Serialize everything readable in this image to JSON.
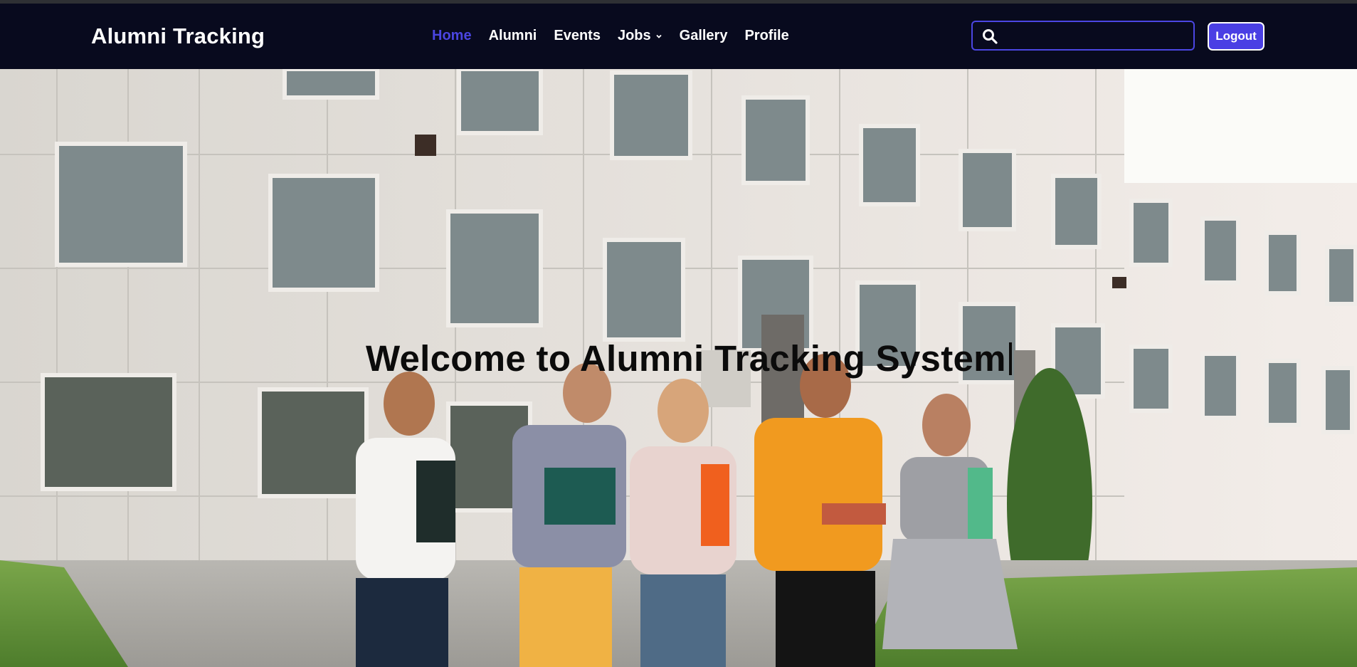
{
  "app": {
    "brand": "Alumni Tracking"
  },
  "nav": {
    "items": [
      {
        "label": "Home",
        "active": true
      },
      {
        "label": "Alumni",
        "active": false
      },
      {
        "label": "Events",
        "active": false
      },
      {
        "label": "Jobs",
        "active": false,
        "has_dropdown": true
      },
      {
        "label": "Gallery",
        "active": false
      },
      {
        "label": "Profile",
        "active": false
      }
    ]
  },
  "search": {
    "value": "",
    "placeholder": "",
    "icon": "search-icon"
  },
  "auth": {
    "logout_label": "Logout"
  },
  "hero": {
    "title": "Welcome to Alumni Tracking System",
    "image": "students-walking-campus-photo"
  },
  "colors": {
    "navbar_bg": "#080a1e",
    "accent": "#4a45e0",
    "text_light": "#ffffff"
  }
}
